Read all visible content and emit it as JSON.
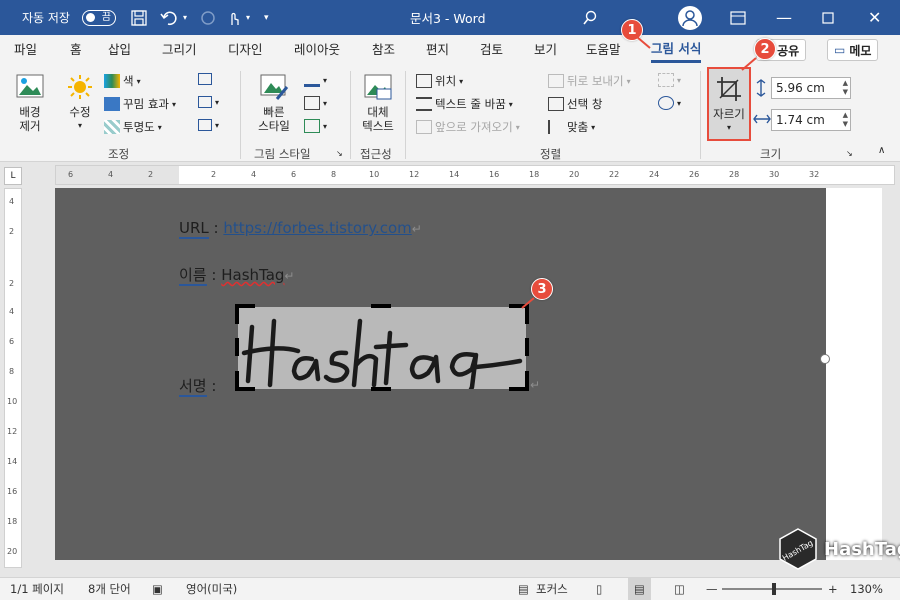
{
  "titlebar": {
    "autosave": "자동 저장",
    "toggle": "끔",
    "doc_title": "문서3 - Word"
  },
  "tabs": [
    "파일",
    "홈",
    "삽입",
    "그리기",
    "디자인",
    "레이아웃",
    "참조",
    "편지",
    "검토",
    "보기",
    "도움말",
    "그림 서식"
  ],
  "share": "공유",
  "memo": "메모",
  "ribbon": {
    "remove_bg": "배경\n제거",
    "correct": "수정",
    "color": "색",
    "artistic": "꾸밈 효과",
    "transparency": "투명도",
    "group_adjust": "조정",
    "quick_styles": "빠른\n스타일",
    "group_styles": "그림 스타일",
    "alt_text": "대체\n텍스트",
    "group_access": "접근성",
    "position": "위치",
    "wrap_text": "텍스트 줄 바꿈",
    "bring_forward": "앞으로 가져오기",
    "send_backward": "뒤로 보내기",
    "selection_pane": "선택 창",
    "align": "맞춤",
    "group_arrange": "정렬",
    "crop": "자르기",
    "height": "5.96 cm",
    "width": "1.74 cm",
    "group_size": "크기"
  },
  "ruler_h": [
    "6",
    "4",
    "2",
    "2",
    "4",
    "6",
    "8",
    "10",
    "12",
    "14",
    "16",
    "18",
    "20",
    "22",
    "24",
    "26",
    "28",
    "30",
    "32"
  ],
  "ruler_v": [
    "4",
    "2",
    "2",
    "4",
    "6",
    "8",
    "10",
    "12",
    "14",
    "16",
    "18",
    "20"
  ],
  "doc": {
    "url_label": "URL",
    "url_value": "https://forbes.tistory.com",
    "name_label": "이름",
    "name_value": "HashTag",
    "sign_label": "서명",
    "sep": ":",
    "signature": "Hashtag"
  },
  "status": {
    "page": "1/1 페이지",
    "words": "8개 단어",
    "lang": "영어(미국)",
    "focus": "포커스",
    "zoom": "130%"
  },
  "callouts": [
    "1",
    "2",
    "3"
  ],
  "watermark": "HashTag"
}
